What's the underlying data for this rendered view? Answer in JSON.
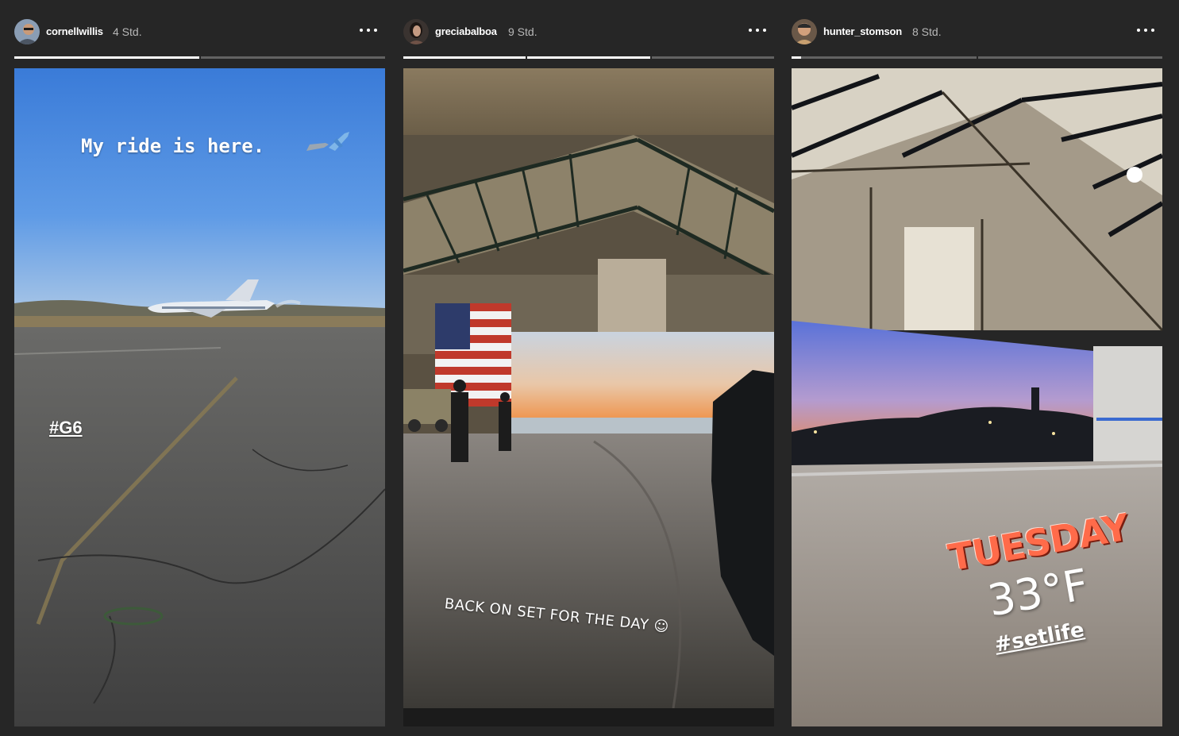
{
  "stories": [
    {
      "username": "cornellwillis",
      "time": "4 Std.",
      "progress": [
        1,
        0
      ],
      "caption": "My ride is here.",
      "hashtag": "#G6"
    },
    {
      "username": "greciabalboa",
      "time": "9 Std.",
      "progress": [
        1,
        1,
        0
      ],
      "caption": "BACK ON SET FOR THE DAY ☺"
    },
    {
      "username": "hunter_stomson",
      "time": "8 Std.",
      "progress": [
        0.05,
        0
      ],
      "line1": "TUESDAY",
      "line2": "33°F",
      "hashtag": "#setlife"
    }
  ],
  "colors": {
    "background": "#262626",
    "sticker_red": "#e8553a"
  }
}
